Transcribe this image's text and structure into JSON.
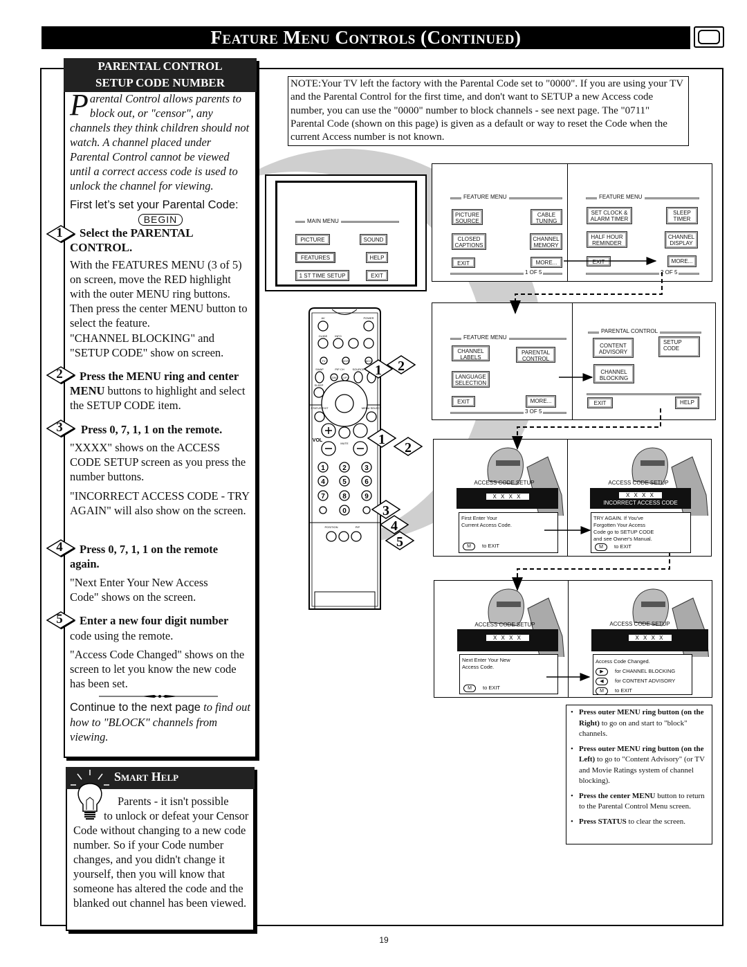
{
  "header": {
    "title": "Feature Menu Controls (Continued)",
    "tv_icon": "tv-icon"
  },
  "left": {
    "title_line1": "PARENTAL CONTROL",
    "title_line2": "SETUP CODE NUMBER",
    "intro_dropcap": "P",
    "intro": "arental Control allows parents to block out, or \"censor\", any channels they think children should not watch. A channel placed under Parental Control cannot be viewed until a correct access code is used to unlock the channel for viewing.",
    "first_line": "First let’s set your Parental Code:",
    "begin": "BEGIN",
    "steps": [
      {
        "num": "1",
        "title": "Select the PARENTAL CONTROL.",
        "paras": [
          "With the FEATURES MENU (3 of 5) on screen, move the RED highlight with the outer MENU ring buttons. Then press the center MENU button to select the feature.",
          "\"CHANNEL BLOCKING\" and \"SETUP CODE\" show on screen."
        ]
      },
      {
        "num": "2",
        "title": "Press the MENU ring and center",
        "title_rest_bold": "MENU",
        "title_rest": " buttons to highlight and select the SETUP CODE item."
      },
      {
        "num": "3",
        "title": "Press 0, 7, 1, 1 on the remote.",
        "paras": [
          "\"XXXX\" shows on the ACCESS CODE SETUP screen as you press the number buttons.",
          "\"INCORRECT ACCESS CODE - TRY AGAIN\" will also show on the screen."
        ]
      },
      {
        "num": "4",
        "title": "Press 0, 7, 1, 1 on the remote again.",
        "paras": [
          "\"Next Enter Your New Access Code\" shows on the screen."
        ]
      },
      {
        "num": "5",
        "title": "Enter a new four digit number",
        "title_rest": "code using the remote.",
        "paras": [
          "\"Access Code Changed\" shows on the screen to let you know the new code has been set."
        ]
      }
    ],
    "continue_plain": "Continue to the next page",
    "continue_italic": " to find out  how to \"BLOCK\" channels from viewing."
  },
  "smart_help": {
    "title": "Smart Help",
    "icon": "lightbulb-icon",
    "text_first": "Parents - it isn't possible",
    "text": "to unlock or defeat your Censor Code without changing to a new code number. So if your Code number changes, and you didn't change it yourself, then you will know that someone has altered the code and the blanked out channel has been viewed."
  },
  "note": "NOTE:Your TV left the factory with the Parental Code set to \"0000\". If you are using your TV and the Parental Control for the first time, and don't want to SETUP a new Access code number, you can use the \"0000\" number to block channels - see next page. The \"0711\" Parental Code (shown on this page) is given as a default or way to reset the Code when the current Access number is not known.",
  "main_menu": {
    "title": "MAIN MENU",
    "buttons": [
      "PICTURE",
      "SOUND",
      "FEATURES",
      "HELP",
      "1 ST TIME SETUP",
      "EXIT"
    ]
  },
  "remote": {
    "labels": [
      "AV",
      "POWER",
      "GUIDE",
      "INFO",
      "TV",
      "VCR",
      "ACC",
      "SWAP",
      "PIP CH",
      "DN",
      "UP",
      "SOURCE",
      "FREEZE",
      "SLEEP",
      "STATUS EXIT",
      "MENU SELECT",
      "VOL",
      "MUTE",
      "POSITION",
      "PIP"
    ],
    "digits": [
      "1",
      "2",
      "3",
      "4",
      "5",
      "6",
      "7",
      "8",
      "9",
      "0"
    ],
    "step_badges": [
      "1",
      "2",
      "1",
      "2",
      "3",
      "4",
      "5"
    ]
  },
  "screens": {
    "s1": {
      "title": "FEATURE MENU",
      "buttons": [
        "PICTURE\nSOURCE",
        "CABLE\nTUNING",
        "CLOSED\nCAPTIONS",
        "CHANNEL\nMEMORY",
        "EXIT",
        "MORE..."
      ],
      "page": "1  OF 5"
    },
    "s2": {
      "title": "FEATURE MENU",
      "buttons": [
        "SET CLOCK &\nALARM TIMER",
        "SLEEP\nTIMER",
        "HALF HOUR\nREMINDER",
        "CHANNEL\nDISPLAY",
        "EXIT",
        "MORE..."
      ],
      "page": "2  OF 5"
    },
    "s3": {
      "title": "FEATURE MENU",
      "buttons": [
        "CHANNEL\nLABELS",
        "PARENTAL\nCONTROL",
        "LANGUAGE\nSELECTION",
        "EXIT",
        "MORE..."
      ],
      "page": "3  OF 5"
    },
    "s4": {
      "title": "PARENTAL CONTROL",
      "buttons": [
        "CONTENT\nADVISORY",
        "SETUP\nCODE",
        "CHANNEL\nBLOCKING",
        "EXIT",
        "HELP"
      ]
    },
    "s5": {
      "title": "ACCESS CODE SETUP",
      "code": "X X X X",
      "lines": [
        "First Enter Your",
        "Current Access Code."
      ],
      "exit_key": "M",
      "exit": "to EXIT"
    },
    "s6": {
      "title": "ACCESS CODE SETUP",
      "code": "X X X X",
      "error": "INCORRECT ACCESS CODE",
      "lines": [
        "TRY AGAIN. If You've",
        "Forgotten Your Access",
        "Code go to SETUP CODE",
        "and see Owner's Manual."
      ],
      "exit_key": "M",
      "exit": "to EXIT"
    },
    "s7": {
      "title": "ACCESS CODE SETUP",
      "code": "X X X X",
      "lines": [
        "Next Enter Your New",
        "Access Code."
      ],
      "exit_key": "M",
      "exit": "to EXIT"
    },
    "s8": {
      "title": "ACCESS CODE SETUP",
      "code": "X X X X",
      "lines": [
        "Access Code Changed."
      ],
      "right_key": "▶",
      "right": "for CHANNEL BLOCKING",
      "left_key": "◀",
      "left": "for CONTENT ADVISORY",
      "exit_key": "M",
      "exit": "to EXIT"
    }
  },
  "notes": [
    {
      "bold": "Press outer MENU ring button (on the Right)",
      "text": " to go on and start to \"block\" channels."
    },
    {
      "bold": "Press outer MENU ring button (on the Left)",
      "text": " to go to \"Content Advisory\" (or TV and Movie Ratings system of channel blocking)."
    },
    {
      "bold": "Press the center MENU",
      "text": " button to return to the Parental Control Menu screen."
    },
    {
      "bold": "Press STATUS",
      "text": " to clear the screen."
    }
  ],
  "page_number": "19"
}
